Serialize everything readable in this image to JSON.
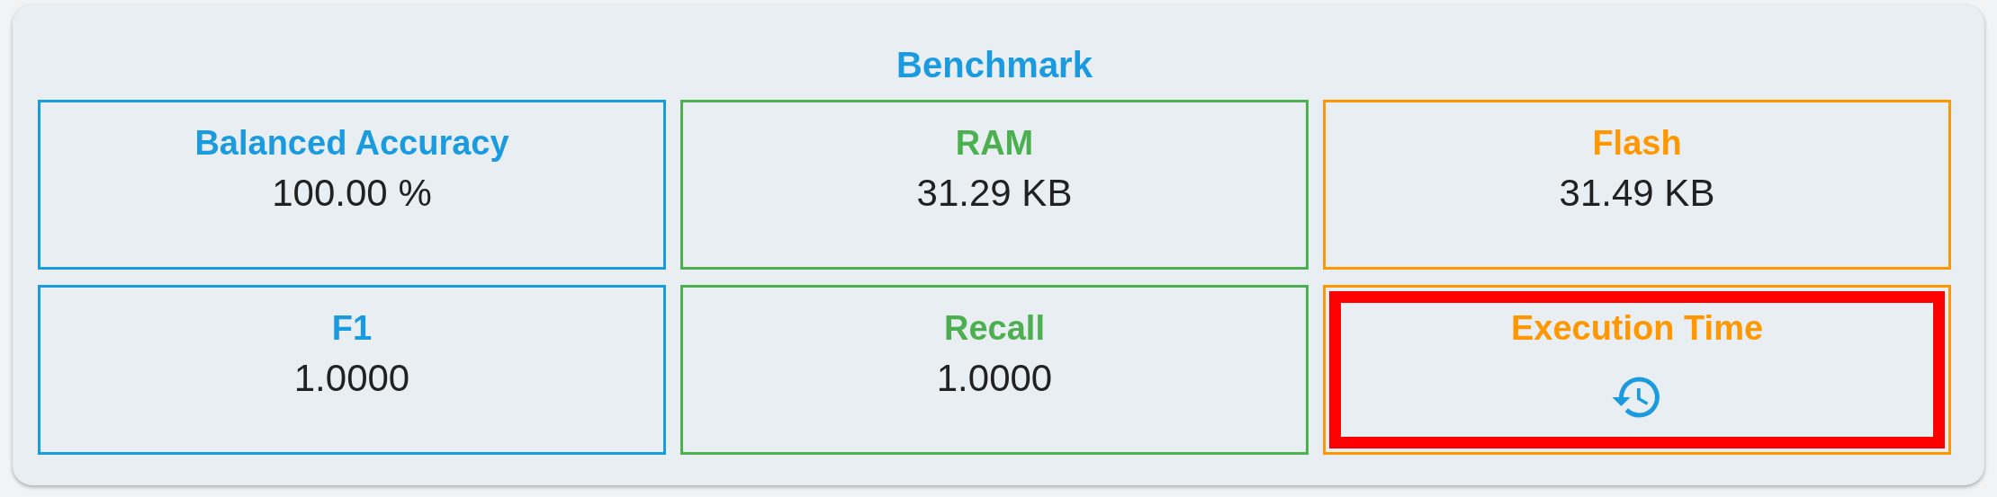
{
  "panel": {
    "title": "Benchmark"
  },
  "tiles": [
    {
      "label": "Balanced Accuracy",
      "kind": "value",
      "value": "100.00 %",
      "color": "#1a9be0",
      "highlighted": false
    },
    {
      "label": "RAM",
      "kind": "value",
      "value": "31.29 KB",
      "color": "#4caf50",
      "highlighted": false
    },
    {
      "label": "Flash",
      "kind": "value",
      "value": "31.49 KB",
      "color": "#ff9800",
      "highlighted": false
    },
    {
      "label": "F1",
      "kind": "value",
      "value": "1.0000",
      "color": "#1a9be0",
      "highlighted": false
    },
    {
      "label": "Recall",
      "kind": "value",
      "value": "1.0000",
      "color": "#4caf50",
      "highlighted": false
    },
    {
      "label": "Execution Time",
      "kind": "icon",
      "color": "#ff9800",
      "highlighted": true
    }
  ]
}
